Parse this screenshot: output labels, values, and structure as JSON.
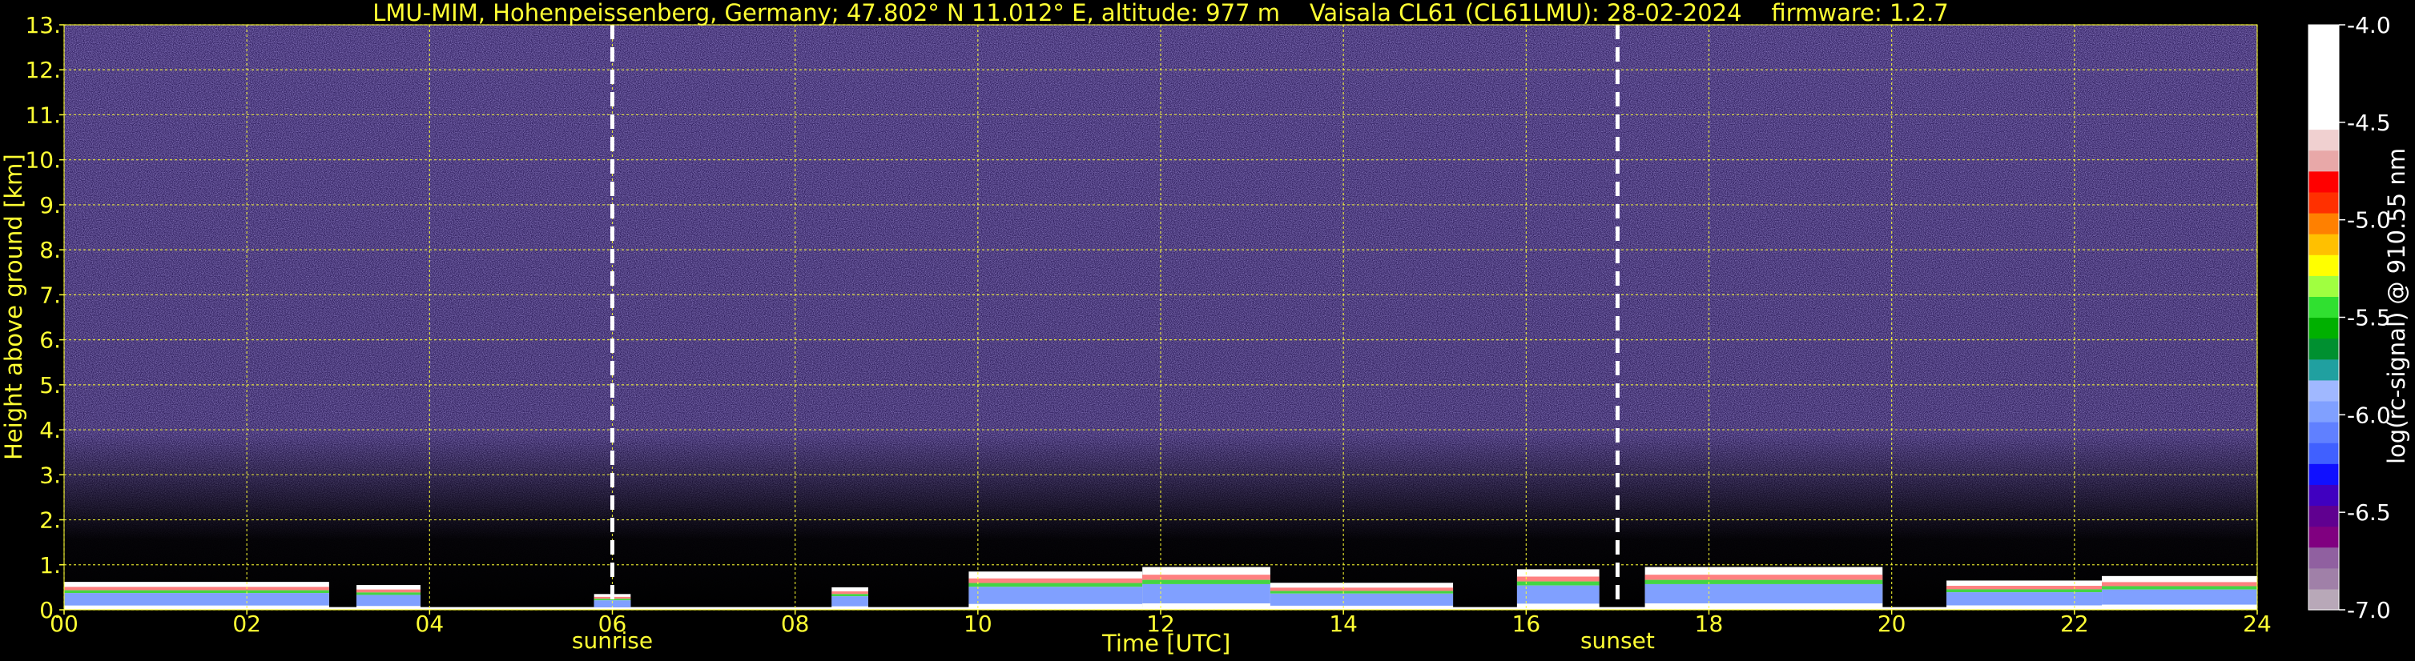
{
  "header": {
    "title": "LMU-MIM, Hohenpeissenberg, Germany; 47.802° N 11.012° E, altitude: 977 m    Vaisala CL61 (CL61LMU): 28-02-2024    firmware: 1.2.7"
  },
  "chart_data": {
    "type": "heatmap",
    "title": "LMU-MIM, Hohenpeissenberg, Germany; 47.802° N 11.012° E, altitude: 977 m    Vaisala CL61 (CL61LMU): 28-02-2024    firmware: 1.2.7",
    "xlabel": "Time [UTC]",
    "ylabel": "Height above ground [km]",
    "xlim": [
      0,
      24
    ],
    "ylim": [
      0,
      13
    ],
    "x_ticks": [
      "00",
      "02",
      "04",
      "06",
      "08",
      "10",
      "12",
      "14",
      "16",
      "18",
      "20",
      "22",
      "24"
    ],
    "y_ticks": [
      "0.",
      "1.",
      "2.",
      "3.",
      "4.",
      "5.",
      "6.",
      "7.",
      "8.",
      "9.",
      "10.",
      "11.",
      "12.",
      "13."
    ],
    "grid": true,
    "grid_color": "#ffff33",
    "annotations": [
      {
        "name": "sunrise",
        "label": "sunrise",
        "x": 6.0
      },
      {
        "name": "sunset",
        "label": "sunset",
        "x": 17.0
      }
    ],
    "colorbar": {
      "label": "log(rc-signal) @ 910.55 nm",
      "range": [
        -7.0,
        -4.0
      ],
      "ticks": [
        "-4.0",
        "-4.5",
        "-5.0",
        "-5.5",
        "-6.0",
        "-6.5",
        "-7.0"
      ],
      "colors": [
        "#b8a8b8",
        "#a080a8",
        "#9060a0",
        "#800080",
        "#600090",
        "#4000c0",
        "#1010ff",
        "#4060ff",
        "#6080ff",
        "#80a0ff",
        "#a0b8ff",
        "#20a0a0",
        "#009030",
        "#00b000",
        "#30e030",
        "#a0ff40",
        "#ffff00",
        "#ffc000",
        "#ff8000",
        "#ff3000",
        "#ff0000",
        "#e8a8a8",
        "#f0d0d0",
        "#ffffff",
        "#ffffff",
        "#ffffff",
        "#ffffff",
        "#ffffff"
      ]
    },
    "low_cloud_segments": [
      {
        "start": 0.0,
        "end": 2.9,
        "top": 0.62
      },
      {
        "start": 3.2,
        "end": 3.9,
        "top": 0.55
      },
      {
        "start": 5.8,
        "end": 6.2,
        "top": 0.35
      },
      {
        "start": 8.4,
        "end": 8.8,
        "top": 0.5
      },
      {
        "start": 9.9,
        "end": 11.8,
        "top": 0.85
      },
      {
        "start": 11.8,
        "end": 13.2,
        "top": 0.95
      },
      {
        "start": 13.2,
        "end": 15.2,
        "top": 0.6
      },
      {
        "start": 15.9,
        "end": 16.8,
        "top": 0.9
      },
      {
        "start": 17.3,
        "end": 19.9,
        "top": 0.95
      },
      {
        "start": 20.6,
        "end": 22.3,
        "top": 0.65
      },
      {
        "start": 22.3,
        "end": 24.0,
        "top": 0.75
      }
    ],
    "background_signal_level": -6.4
  }
}
